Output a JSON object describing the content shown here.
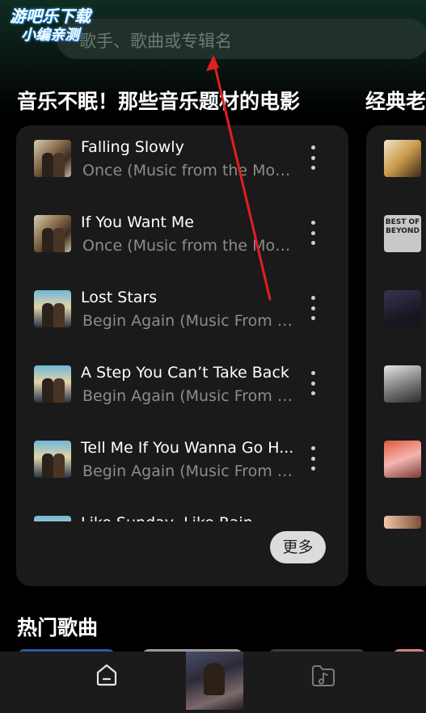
{
  "watermark": {
    "line1": "游吧乐下载",
    "line2": "小编亲测"
  },
  "search": {
    "placeholder": "歌手、歌曲或专辑名"
  },
  "sections": {
    "movie_music": {
      "title": "音乐不眠！那些音乐题材的电影"
    },
    "classic": {
      "title": "经典老"
    },
    "hot": {
      "title": "热门歌曲"
    }
  },
  "songs": [
    {
      "title": "Falling Slowly",
      "subtitle": "Once (Music from the Moti...",
      "cover": "once"
    },
    {
      "title": "If You Want Me",
      "subtitle": "Once (Music from the Moti...",
      "cover": "once"
    },
    {
      "title": "Lost Stars",
      "subtitle": "Begin Again (Music From a...",
      "cover": "begin"
    },
    {
      "title": "A Step You Can’t Take Back",
      "subtitle": "Begin Again (Music From a...",
      "cover": "begin"
    },
    {
      "title": "Tell Me If You Wanna Go H...",
      "subtitle": "Begin Again (Music From a...",
      "cover": "begin"
    },
    {
      "title": "Like Sunday, Like Rain",
      "subtitle": "",
      "cover": "begin"
    }
  ],
  "more_button": {
    "label": "更多"
  },
  "side_thumbs": {
    "album_text": "BEST OF BEYOND"
  },
  "nav": {
    "home_icon": "home-icon",
    "now_playing_icon": "album-cover",
    "music_folder_icon": "music-folder-icon"
  },
  "colors": {
    "arrow": "#e02020",
    "card_bg": "#1a1a1a",
    "more_btn_bg": "#dcdcdc"
  }
}
